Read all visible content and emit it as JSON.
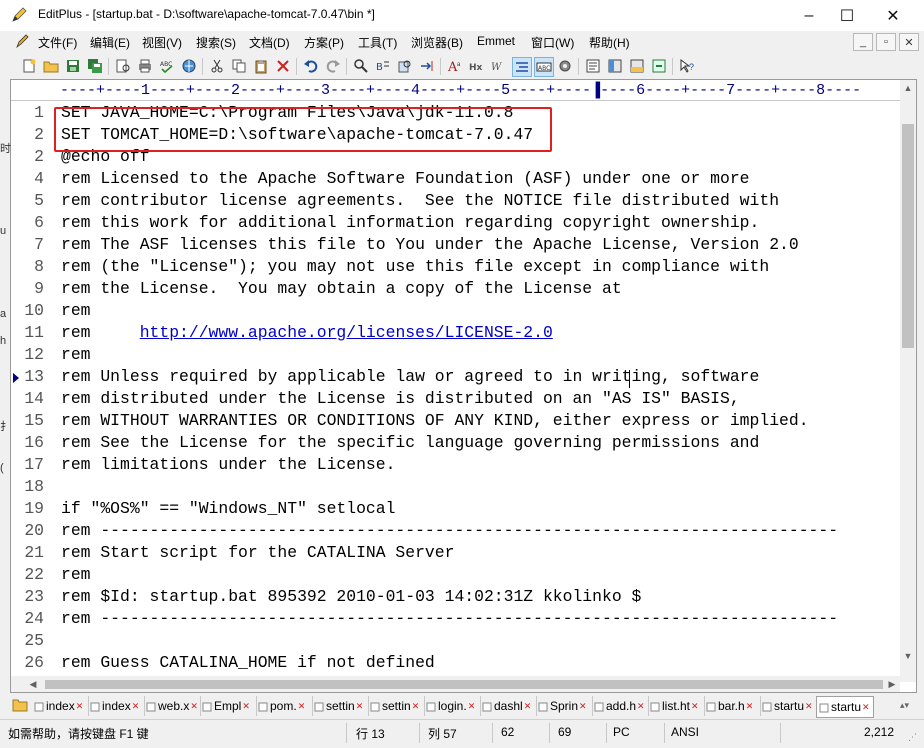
{
  "window": {
    "title": "EditPlus - [startup.bat - D:\\software\\apache-tomcat-7.0.47\\bin *]",
    "minimize": "–",
    "maximize": "☐",
    "close": "✕"
  },
  "menu": {
    "items": [
      "文件(F)",
      "编辑(E)",
      "视图(V)",
      "搜索(S)",
      "文档(D)",
      "方案(P)",
      "工具(T)",
      "浏览器(B)",
      "Emmet",
      "窗口(W)",
      "帮助(H)"
    ],
    "mdi": [
      "_",
      "▫",
      "✕"
    ]
  },
  "ruler": {
    "text": "----+----1----+----2----+----3----+----4----+----5----+----▐----6----+----7----+----8----"
  },
  "editor": {
    "lines": [
      {
        "n": "1",
        "t": "SET JAVA_HOME=C:\\Program Files\\Java\\jdk-11.0.8"
      },
      {
        "n": "2",
        "t": "SET TOMCAT_HOME=D:\\software\\apache-tomcat-7.0.47"
      },
      {
        "n": "2",
        "t": "@echo off"
      },
      {
        "n": "4",
        "t": "rem Licensed to the Apache Software Foundation (ASF) under one or more"
      },
      {
        "n": "5",
        "t": "rem contributor license agreements.  See the NOTICE file distributed with"
      },
      {
        "n": "6",
        "t": "rem this work for additional information regarding copyright ownership."
      },
      {
        "n": "7",
        "t": "rem The ASF licenses this file to You under the Apache License, Version 2.0"
      },
      {
        "n": "8",
        "t": "rem (the \"License\"); you may not use this file except in compliance with"
      },
      {
        "n": "9",
        "t": "rem the License.  You may obtain a copy of the License at"
      },
      {
        "n": "10",
        "t": "rem"
      },
      {
        "n": "11",
        "t": "rem     ",
        "link": "http://www.apache.org/licenses/LICENSE-2.0"
      },
      {
        "n": "12",
        "t": "rem"
      },
      {
        "n": "13",
        "t": "rem Unless required by applicable law or agreed to in writing, software"
      },
      {
        "n": "14",
        "t": "rem distributed under the License is distributed on an \"AS IS\" BASIS,"
      },
      {
        "n": "15",
        "t": "rem WITHOUT WARRANTIES OR CONDITIONS OF ANY KIND, either express or implied."
      },
      {
        "n": "16",
        "t": "rem See the License for the specific language governing permissions and"
      },
      {
        "n": "17",
        "t": "rem limitations under the License."
      },
      {
        "n": "18",
        "t": ""
      },
      {
        "n": "19",
        "t": "if \"%OS%\" == \"Windows_NT\" setlocal"
      },
      {
        "n": "20",
        "t": "rem ---------------------------------------------------------------------------"
      },
      {
        "n": "21",
        "t": "rem Start script for the CATALINA Server"
      },
      {
        "n": "22",
        "t": "rem"
      },
      {
        "n": "23",
        "t": "rem $Id: startup.bat 895392 2010-01-03 14:02:31Z kkolinko $"
      },
      {
        "n": "24",
        "t": "rem ---------------------------------------------------------------------------"
      },
      {
        "n": "25",
        "t": ""
      },
      {
        "n": "26",
        "t": "rem Guess CATALINA_HOME if not defined"
      }
    ]
  },
  "tabs": [
    {
      "label": "index",
      "active": false
    },
    {
      "label": "index",
      "active": false
    },
    {
      "label": "web.x",
      "active": false
    },
    {
      "label": "Empl",
      "active": false
    },
    {
      "label": "pom.",
      "active": false
    },
    {
      "label": "settin",
      "active": false
    },
    {
      "label": "settin",
      "active": false
    },
    {
      "label": "login.",
      "active": false
    },
    {
      "label": "dashl",
      "active": false
    },
    {
      "label": "Sprin",
      "active": false
    },
    {
      "label": "add.h",
      "active": false
    },
    {
      "label": "list.ht",
      "active": false
    },
    {
      "label": "bar.h",
      "active": false
    },
    {
      "label": "startu",
      "active": false
    },
    {
      "label": "startu",
      "active": true
    }
  ],
  "status": {
    "help": "如需帮助，请按键盘 F1 键",
    "row": "行 13",
    "col": "列 57",
    "v1": "62",
    "v2": "69",
    "mode": "PC",
    "encoding": "ANSI",
    "size": "2,212"
  },
  "desktop_left_chars": [
    "时",
    "u",
    "a",
    "h",
    "扌",
    "("
  ]
}
